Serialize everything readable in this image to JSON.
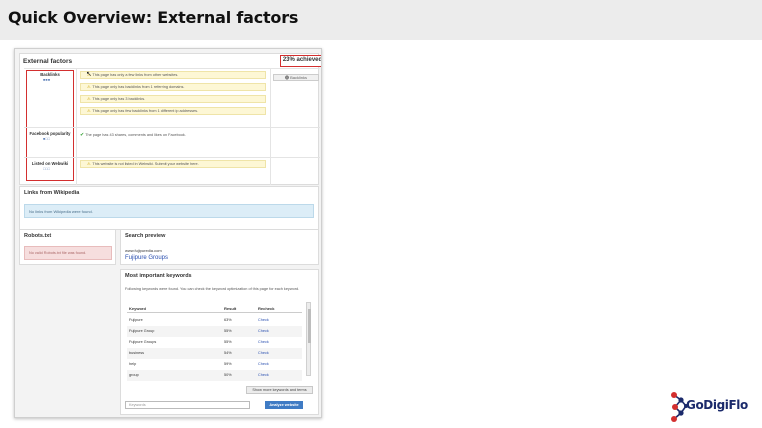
{
  "slide": {
    "title": "Quick Overview: External factors"
  },
  "external_factors": {
    "title": "External factors",
    "achieved": "23% achieved",
    "backlinks": {
      "label": "Backlinks",
      "meter": "■■■",
      "messages": [
        "This page has only a few links from other websites.",
        "This page only has backlinks from 1 referring domains.",
        "This page only has 3 backlinks.",
        "This page only has few backlinks from 1 different ip addresses."
      ],
      "button": "Backlinks"
    },
    "facebook": {
      "label": "Facebook popularity",
      "meter": "■□□",
      "message": "The page has 43 shares, comments and likes on Facebook."
    },
    "webwiki": {
      "label": "Listed on Webwiki",
      "meter": "□□□",
      "message": "This website is not listed in Webwiki. Submit your website here."
    }
  },
  "wikipedia": {
    "title": "Links from Wikipedia",
    "message": "No links from Wikipedia were found."
  },
  "robots": {
    "title": "Robots.txt",
    "message": "No valid Robots.txt file was found."
  },
  "search_preview": {
    "title": "Search preview",
    "url": "www.fujipuredia.com",
    "page_title": "Fujipure Groups"
  },
  "keywords": {
    "title": "Most important keywords",
    "description": "Following keywords were found. You can check the keyword optimization of this page for each keyword.",
    "columns": [
      "Keyword",
      "Result",
      "Recheck"
    ],
    "rows": [
      [
        "Fujipure",
        "63%",
        "Check"
      ],
      [
        "Fujipure Group",
        "55%",
        "Check"
      ],
      [
        "Fujipure Groups",
        "55%",
        "Check"
      ],
      [
        "business",
        "54%",
        "Check"
      ],
      [
        "help",
        "59%",
        "Check"
      ],
      [
        "group",
        "50%",
        "Check"
      ]
    ],
    "more_button": "Show more keywords and terms",
    "input_placeholder": "Keywords",
    "analyze_button": "Analyze website"
  },
  "brand": {
    "name": "GoDigiFlo",
    "colors": {
      "primary": "#1b2a6b",
      "accent": "#d32f2f"
    }
  }
}
